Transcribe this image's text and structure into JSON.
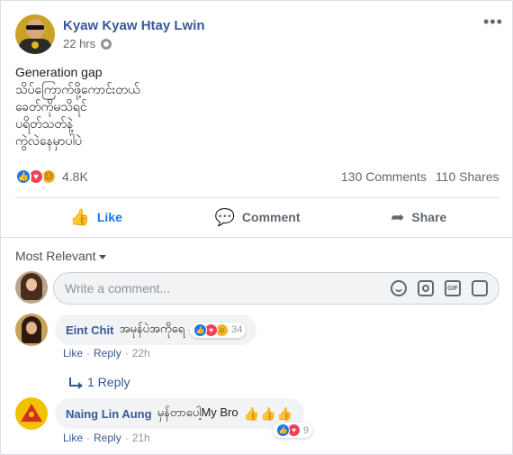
{
  "post": {
    "author": "Kyaw Kyaw Htay Lwin",
    "time": "22 hrs",
    "more_label": "•••",
    "text_lines": [
      "Generation gap",
      "သိပ်ကြောက်ဖို့ကောင်းတယ်",
      "ခေတ်ကိုမသိရင်",
      "ပရိတ်သတ်နဲ့",
      "ကွဲလဲနေမှာပါပဲ"
    ],
    "reactions": {
      "types": [
        "like",
        "love",
        "sad"
      ],
      "count": "4.8K"
    },
    "comments_count": "130 Comments",
    "shares_count": "110 Shares"
  },
  "actions": {
    "like": "Like",
    "comment": "Comment",
    "share": "Share"
  },
  "comments_section": {
    "sort_label": "Most Relevant",
    "input_placeholder": "Write a comment...",
    "input_icons": [
      "emoji-icon",
      "camera-icon",
      "gif-icon",
      "sticker-icon"
    ],
    "gif_text": "GIF"
  },
  "comments": [
    {
      "name": "Eint Chit",
      "text": "အမုန်ပဲအကိုရေ",
      "reactions": [
        "like",
        "love",
        "haha"
      ],
      "reaction_count": "34",
      "like": "Like",
      "reply": "Reply",
      "time": "22h",
      "replies_label": "1 Reply"
    },
    {
      "name": "Naing Lin Aung",
      "text": "မှန်တာပေါ့My Bro",
      "emoji": "👍👍👍",
      "reactions": [
        "like",
        "love"
      ],
      "reaction_count": "9",
      "like": "Like",
      "reply": "Reply",
      "time": "21h"
    }
  ],
  "colors": {
    "link_blue": "#385898",
    "like_blue": "#1877f2",
    "love_red": "#f33e58",
    "yellow": "#f7b125"
  }
}
